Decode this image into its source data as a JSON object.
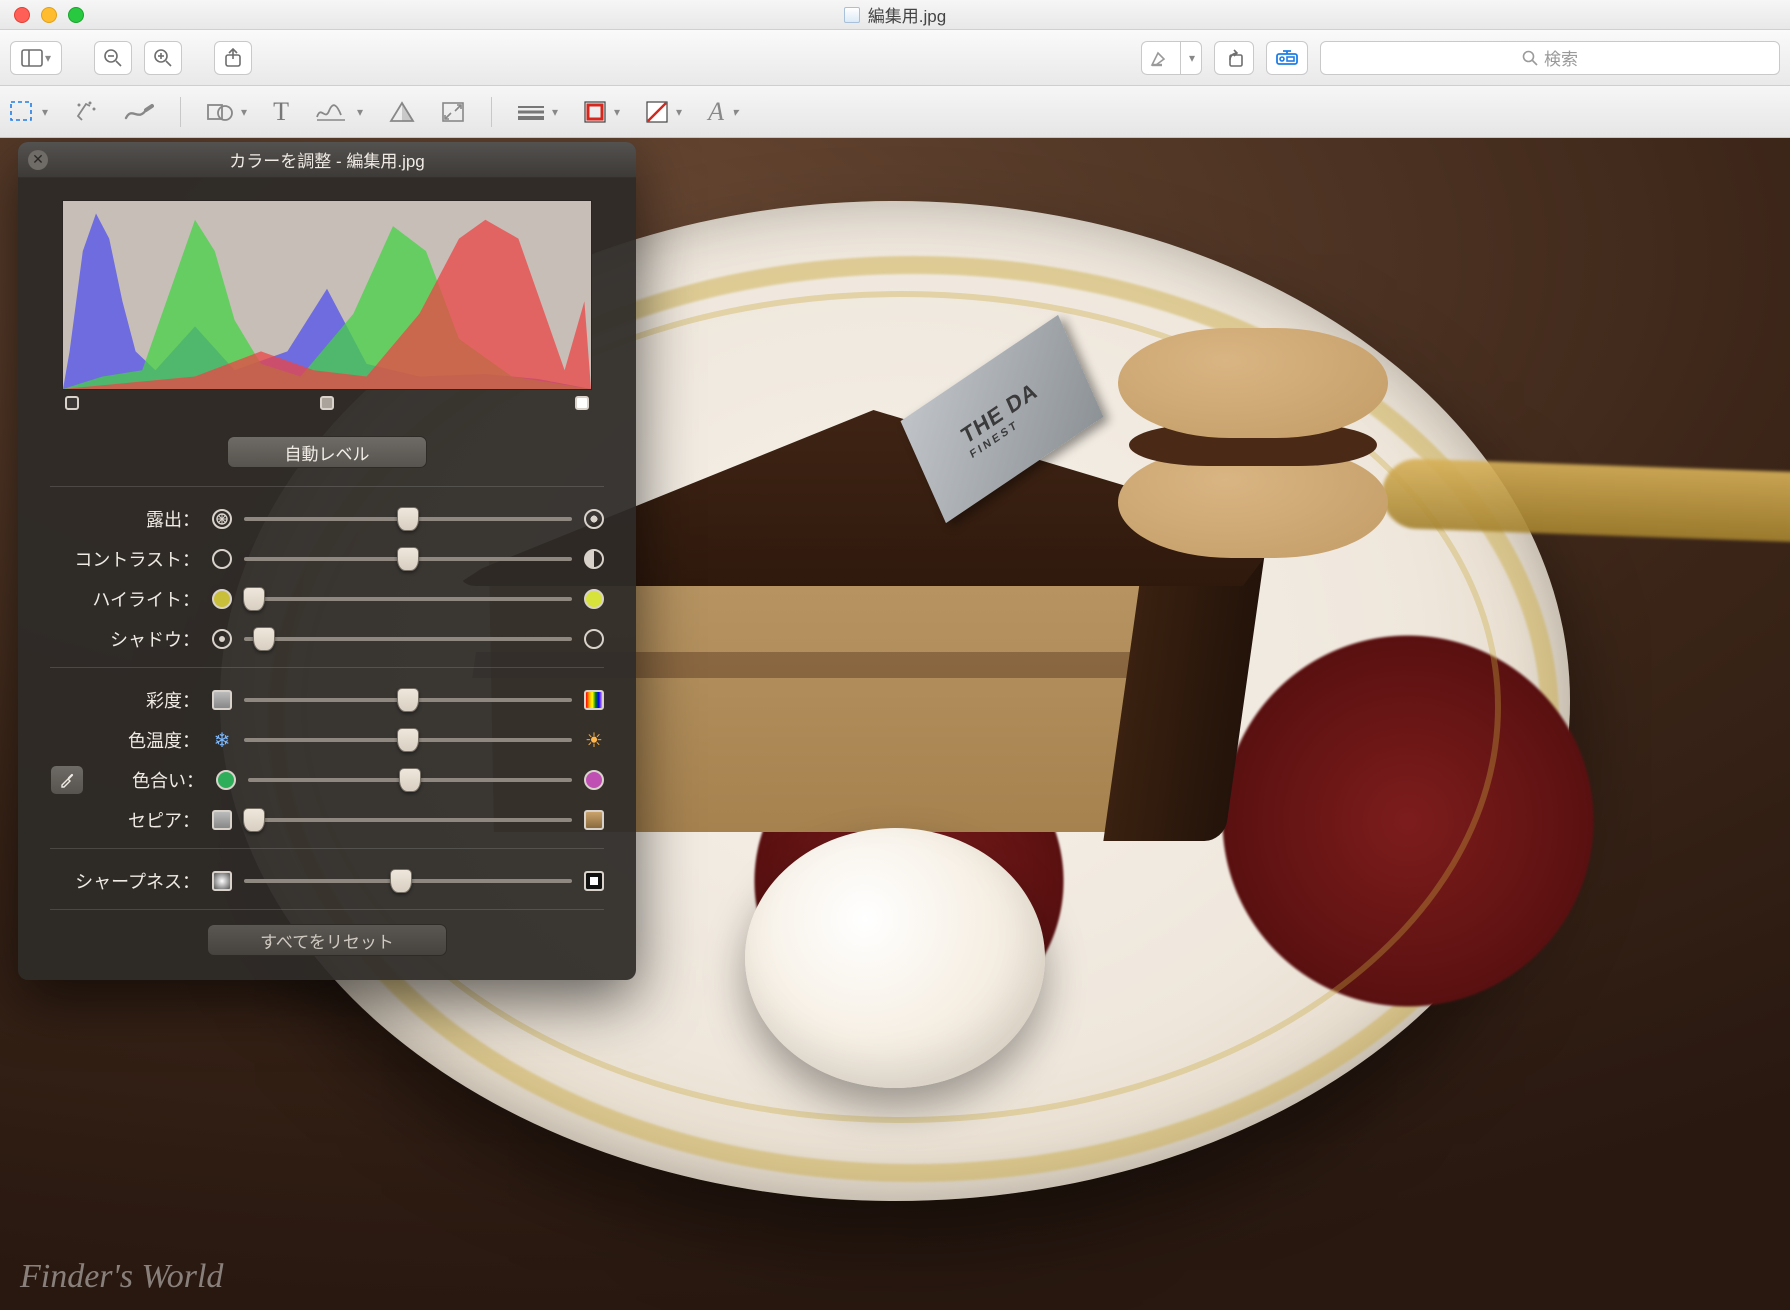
{
  "window": {
    "title": "編集用.jpg"
  },
  "toolbar1": {
    "sidebar_tooltip": "サイドバー",
    "zoom_out_tooltip": "縮小",
    "zoom_in_tooltip": "拡大",
    "share_tooltip": "共有",
    "highlight_tooltip": "ハイライト",
    "rotate_tooltip": "回転",
    "markup_tooltip": "マークアップ"
  },
  "search": {
    "placeholder": "検索"
  },
  "toolbar2": {
    "selection_tooltip": "選択",
    "instant_alpha_tooltip": "インスタントアルファ",
    "draw_tooltip": "スケッチ",
    "shapes_tooltip": "シェイプ",
    "text_tooltip": "テキスト",
    "sign_tooltip": "署名",
    "adjust_color_tooltip": "カラーを調整",
    "adjust_size_tooltip": "サイズを調整",
    "border_style_tooltip": "線のスタイル",
    "border_color_tooltip": "枠線カラー",
    "fill_color_tooltip": "塗りつぶしカラー",
    "font_tooltip": "フォント"
  },
  "panel": {
    "title": "カラーを調整 - 編集用.jpg",
    "auto_levels": "自動レベル",
    "reset_all": "すべてをリセット",
    "sliders": {
      "exposure": {
        "label": "露出：",
        "value": 50
      },
      "contrast": {
        "label": "コントラスト：",
        "value": 50
      },
      "highlights": {
        "label": "ハイライト：",
        "value": 3
      },
      "shadows": {
        "label": "シャドウ：",
        "value": 6
      },
      "saturation": {
        "label": "彩度：",
        "value": 50
      },
      "temperature": {
        "label": "色温度：",
        "value": 50
      },
      "tint": {
        "label": "色合い：",
        "value": 50
      },
      "sepia": {
        "label": "セピア：",
        "value": 3
      },
      "sharpness": {
        "label": "シャープネス：",
        "value": 48
      }
    }
  },
  "image": {
    "tag_text": "THE DA",
    "tag_sub": "FINEST",
    "watermark": "Finder's World"
  }
}
